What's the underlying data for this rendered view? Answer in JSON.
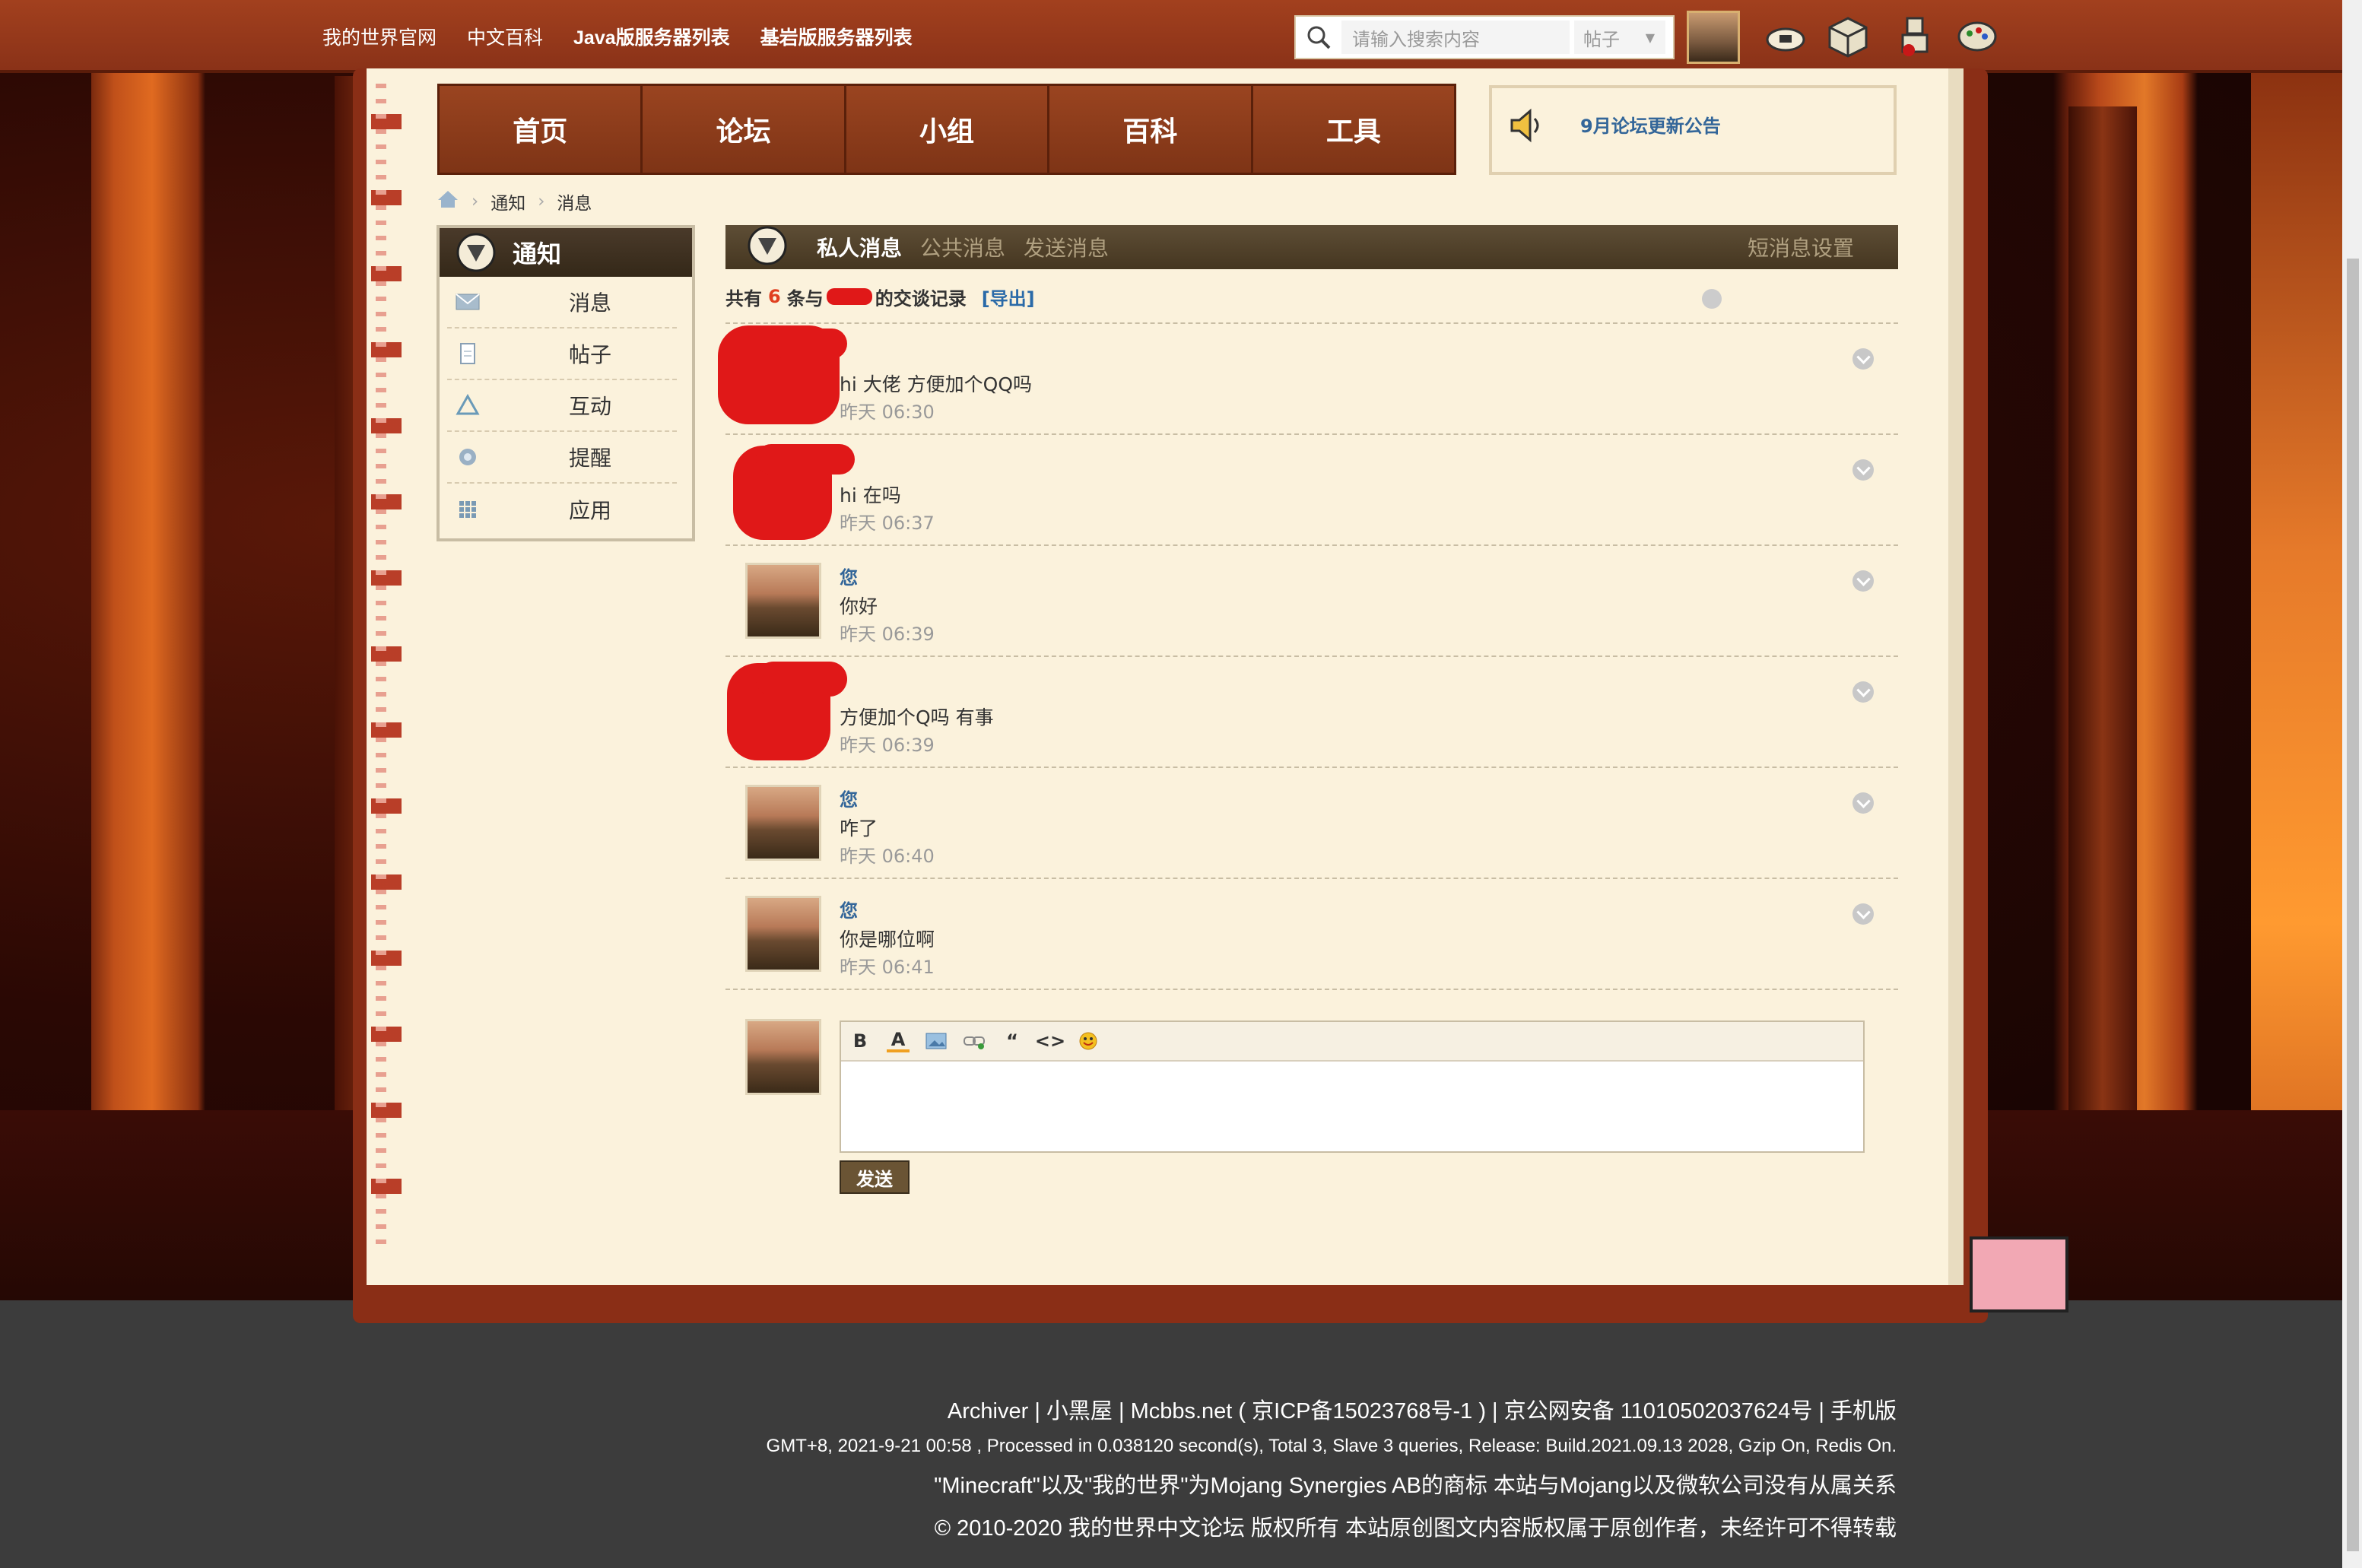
{
  "topbar": {
    "links": [
      "我的世界官网",
      "中文百科",
      "Java版服务器列表",
      "基岩版服务器列表"
    ],
    "search_placeholder": "请输入搜索内容",
    "search_type": "帖子"
  },
  "nav": {
    "tabs": [
      "首页",
      "论坛",
      "小组",
      "百科",
      "工具"
    ],
    "notice": "9月论坛更新公告"
  },
  "breadcrumb": [
    "通知",
    "消息"
  ],
  "sidebar": {
    "title": "通知",
    "items": [
      "消息",
      "帖子",
      "互动",
      "提醒",
      "应用"
    ]
  },
  "msgbar": {
    "tabs": [
      "私人消息",
      "公共消息",
      "发送消息"
    ],
    "settings": "短消息设置"
  },
  "summary": {
    "prefix": "共有",
    "count": "6",
    "mid": "条与",
    "suffix": "的交谈记录",
    "export": "[导出]"
  },
  "messages": [
    {
      "who": "",
      "text": "hi 大佬 方便加个QQ吗",
      "time": "昨天 06:30"
    },
    {
      "who": "",
      "text": "hi 在吗",
      "time": "昨天 06:37"
    },
    {
      "who": "您",
      "text": "你好",
      "time": "昨天 06:39"
    },
    {
      "who": "",
      "text": "方便加个Q吗 有事",
      "time": "昨天 06:39"
    },
    {
      "who": "您",
      "text": "咋了",
      "time": "昨天 06:40"
    },
    {
      "who": "您",
      "text": "你是哪位啊",
      "time": "昨天 06:41"
    }
  ],
  "composer": {
    "send": "发送"
  },
  "footer": {
    "line1": "Archiver | 小黑屋 | Mcbbs.net ( 京ICP备15023768号-1 ) | 京公网安备 11010502037624号 | 手机版",
    "line2": "GMT+8, 2021-9-21 00:58 , Processed in 0.038120 second(s), Total 3, Slave 3 queries, Release: Build.2021.09.13 2028, Gzip On, Redis On.",
    "line3": "\"Minecraft\"以及\"我的世界\"为Mojang Synergies AB的商标 本站与Mojang以及微软公司没有从属关系",
    "line4": "© 2010-2020 我的世界中文论坛 版权所有 本站原创图文内容版权属于原创作者，未经许可不得转载"
  }
}
